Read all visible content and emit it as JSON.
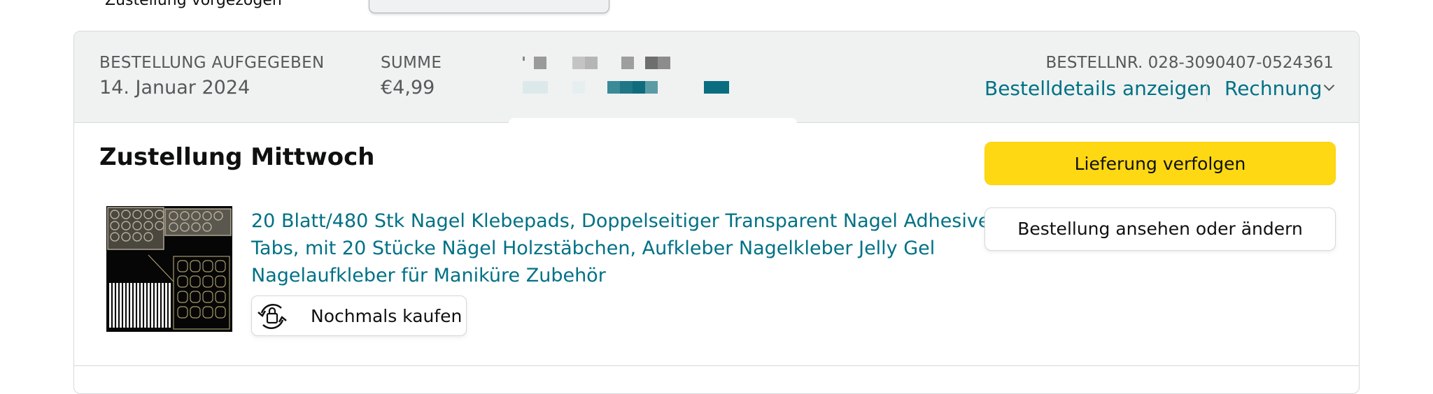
{
  "top": {
    "clipped_text": "Zustellung vorgezogen"
  },
  "header": {
    "placed_label": "BESTELLUNG AUFGEGEBEN",
    "placed_date": "14. Januar 2024",
    "total_label": "SUMME",
    "total_value": "€4,99",
    "order_number": "BESTELLNR. 028-3090407-0524361",
    "details_link": "Bestelldetails anzeigen",
    "invoice_link": "Rechnung",
    "invoice_icon": "chevron-down-icon"
  },
  "shipment": {
    "delivery_status": "Zustellung Mittwoch",
    "product_title": "20 Blatt/480 Stk Nagel Klebepads, Doppelseitiger Transparent Nagel Adhesive Tabs, mit 20 Stücke Nägel Holzstäbchen, Aufkleber Nagelkleber Jelly Gel Nagelaufkleber für Maniküre Zubehör",
    "buy_again_label": "Nochmals kaufen",
    "buy_again_icon": "buy-again-icon",
    "track_button": "Lieferung verfolgen",
    "view_edit_button": "Bestellung ansehen oder ändern"
  },
  "colors": {
    "link": "#007185",
    "primary_button": "#ffd814",
    "header_bg": "#f0f2f2",
    "muted_text": "#565959",
    "border": "#d5d9d9"
  }
}
